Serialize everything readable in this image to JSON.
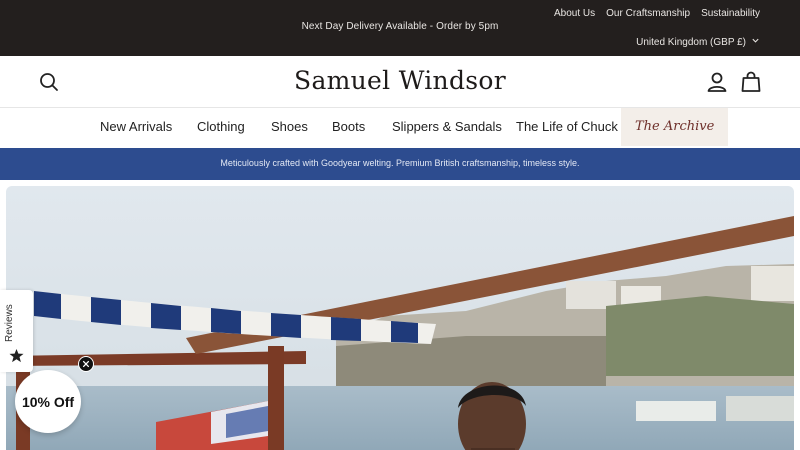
{
  "topbar": {
    "promo": "Next Day Delivery Available - Order by 5pm",
    "links": [
      "About Us",
      "Our Craftsmanship",
      "Sustainability"
    ],
    "region": "United Kingdom (GBP £)"
  },
  "header": {
    "logo": "Samuel Windsor"
  },
  "nav": {
    "items": [
      "New Arrivals",
      "Clothing",
      "Shoes",
      "Boots",
      "Slippers & Sandals",
      "The Life of Chuck"
    ],
    "archive": "The Archive"
  },
  "banner": {
    "text": "Meticulously crafted with Goodyear welting. Premium British craftsmanship, timeless style."
  },
  "widgets": {
    "reviews_label": "Reviews",
    "discount_label": "10% Off"
  },
  "colors": {
    "topbar_bg": "#231f1e",
    "banner_bg": "#2d4c8f",
    "archive_text": "#6e2f2a"
  }
}
